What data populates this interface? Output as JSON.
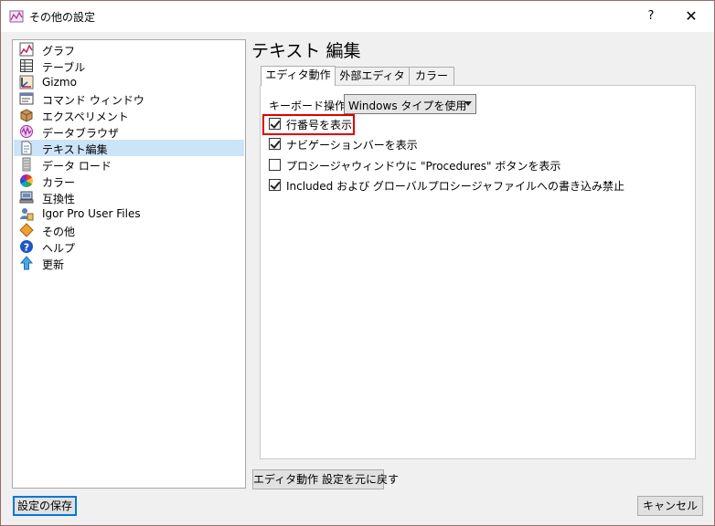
{
  "window": {
    "title": "その他の設定",
    "help": "?",
    "close": "✕"
  },
  "sidebar": {
    "items": [
      {
        "label": "グラフ",
        "icon": "graph-icon"
      },
      {
        "label": "テーブル",
        "icon": "table-icon"
      },
      {
        "label": "Gizmo",
        "icon": "gizmo-icon"
      },
      {
        "label": "コマンド ウィンドウ",
        "icon": "command-window-icon"
      },
      {
        "label": "エクスペリメント",
        "icon": "experiment-icon"
      },
      {
        "label": "データブラウザ",
        "icon": "data-browser-icon"
      },
      {
        "label": "テキスト編集",
        "icon": "text-edit-icon",
        "selected": true
      },
      {
        "label": "データ ロード",
        "icon": "data-load-icon"
      },
      {
        "label": "カラー",
        "icon": "color-wheel-icon"
      },
      {
        "label": "互換性",
        "icon": "compatibility-icon"
      },
      {
        "label": "Igor Pro User Files",
        "icon": "user-files-icon"
      },
      {
        "label": "その他",
        "icon": "misc-icon"
      },
      {
        "label": "ヘルプ",
        "icon": "help-icon"
      },
      {
        "label": "更新",
        "icon": "update-icon"
      }
    ]
  },
  "main": {
    "title": "テキスト 編集",
    "tabs": [
      {
        "label": "エディタ動作",
        "active": true
      },
      {
        "label": "外部エディタ"
      },
      {
        "label": "カラー"
      }
    ],
    "keyboard": {
      "label": "キーボード操作:",
      "value": "Windows タイプを使用"
    },
    "options": [
      {
        "label": "行番号を表示",
        "checked": true
      },
      {
        "label": "ナビゲーションバーを表示",
        "checked": true
      },
      {
        "label": "プロシージャウィンドウに \"Procedures\" ボタンを表示",
        "checked": false
      },
      {
        "label": "Included および グローバルプロシージャファイルへの書き込み禁止",
        "checked": true
      }
    ],
    "reset_button": "エディタ動作 設定を元に戻す"
  },
  "footer": {
    "save_button": "設定の保存",
    "cancel_button": "キャンセル"
  },
  "colors": {
    "selection": "#cce4f7",
    "highlight_border": "#e00000",
    "default_button_border": "#0078d7"
  }
}
